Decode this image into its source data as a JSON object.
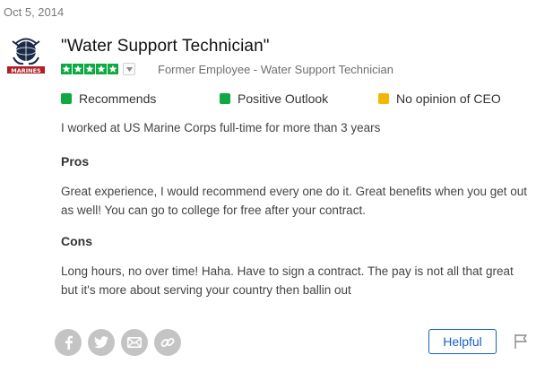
{
  "review": {
    "date": "Oct 5, 2014",
    "company_logo_text": "MARINES",
    "title": "\"Water Support Technician\"",
    "rating": 5,
    "employee_status": "Former Employee - Water Support Technician",
    "indicators": [
      {
        "label": "Recommends",
        "color": "#0caa41"
      },
      {
        "label": "Positive Outlook",
        "color": "#0caa41"
      },
      {
        "label": "No opinion of CEO",
        "color": "#f2b705"
      }
    ],
    "summary": "I worked at US Marine Corps full-time for more than 3 years",
    "pros_heading": "Pros",
    "pros_text": "Great experience, I would recommend every one do it. Great benefits when you get out as well! You can go to college for free after your contract.",
    "cons_heading": "Cons",
    "cons_text": "Long hours, no over time! Haha. Have to sign a contract. The pay is not all that great but it's more about serving your country then ballin out"
  },
  "actions": {
    "share_icons": [
      "facebook-icon",
      "twitter-icon",
      "email-icon",
      "link-icon"
    ],
    "helpful_label": "Helpful",
    "flag_icon": "flag-icon"
  },
  "colors": {
    "rating_green": "#0caa41",
    "helpful_blue": "#1861bf",
    "social_gray": "#c4c4c4"
  }
}
